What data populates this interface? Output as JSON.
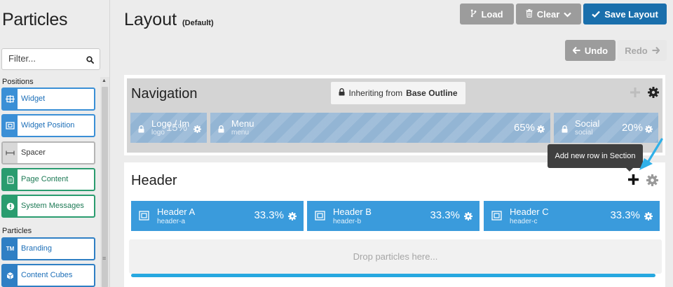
{
  "sidebar": {
    "title": "Particles",
    "filter_placeholder": "Filter...",
    "positions_label": "Positions",
    "particles_label": "Particles",
    "positions": [
      {
        "label": "Widget",
        "icon": "widget-icon",
        "color": "blue"
      },
      {
        "label": "Widget Position",
        "icon": "widget-position-icon",
        "color": "blue"
      },
      {
        "label": "Spacer",
        "icon": "spacer-icon",
        "color": "gray"
      },
      {
        "label": "Page Content",
        "icon": "page-content-icon",
        "color": "green"
      },
      {
        "label": "System Messages",
        "icon": "system-messages-icon",
        "color": "green"
      }
    ],
    "particles": [
      {
        "label": "Branding",
        "icon": "branding-icon",
        "icon_text": "TM",
        "color": "navy"
      },
      {
        "label": "Content Cubes",
        "icon": "content-cubes-icon",
        "color": "navy"
      }
    ]
  },
  "main": {
    "title": "Layout",
    "subtitle": "(Default)",
    "toolbar": {
      "load_label": "Load",
      "clear_label": "Clear",
      "save_label": "Save Layout",
      "undo_label": "Undo",
      "redo_label": "Redo"
    },
    "navigation": {
      "name": "Navigation",
      "inherit_prefix": "Inheriting from",
      "inherit_source": "Base Outline",
      "blocks": [
        {
          "name": "Logo / Im",
          "slug": "logo",
          "percent": "15%"
        },
        {
          "name": "Menu",
          "slug": "menu",
          "percent": "65%"
        },
        {
          "name": "Social",
          "slug": "social",
          "percent": "20%"
        }
      ]
    },
    "header": {
      "name": "Header",
      "blocks": [
        {
          "name": "Header A",
          "slug": "header-a",
          "percent": "33.3%"
        },
        {
          "name": "Header B",
          "slug": "header-b",
          "percent": "33.3%"
        },
        {
          "name": "Header C",
          "slug": "header-c",
          "percent": "33.3%"
        }
      ],
      "drop_text": "Drop particles here...",
      "tooltip": "Add new row in Section"
    }
  },
  "colors": {
    "accent_blue": "#3a9bdc",
    "save_blue": "#1a6fac",
    "inactive_block": "#93b5d4",
    "progress_bar": "#27a8e0",
    "annotation_arrow": "#2fb0e8"
  }
}
